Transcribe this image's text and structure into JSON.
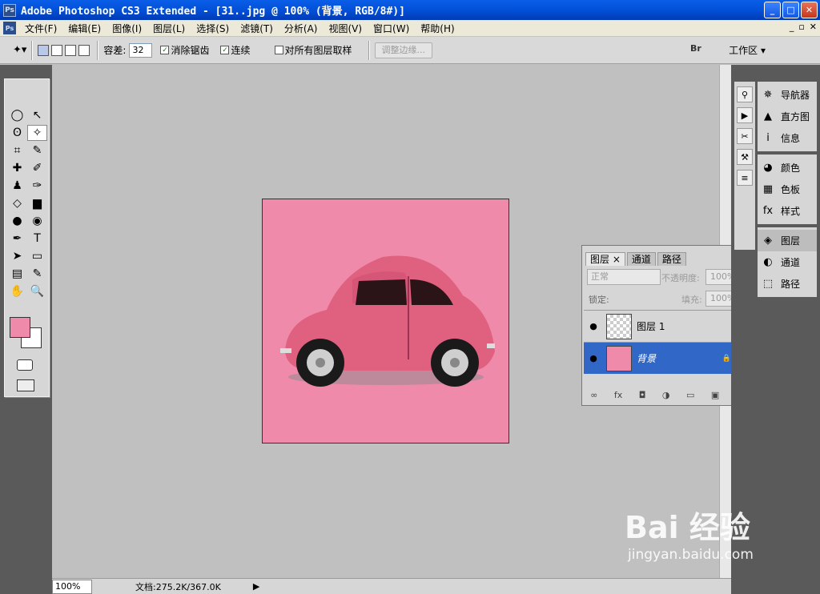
{
  "window": {
    "app_icon": "Ps",
    "title": "Adobe Photoshop CS3 Extended - [31..jpg @ 100% (背景, RGB/8#)]",
    "min": "_",
    "max": "□",
    "close": "✕"
  },
  "menu": {
    "doc_icon": "Ps",
    "items": [
      "文件(F)",
      "编辑(E)",
      "图像(I)",
      "图层(L)",
      "选择(S)",
      "滤镜(T)",
      "分析(A)",
      "视图(V)",
      "窗口(W)",
      "帮助(H)"
    ],
    "doc_min": "_",
    "doc_restore": "▫",
    "doc_close": "✕"
  },
  "options": {
    "tool_icon": "✦▾",
    "tolerance_label": "容差:",
    "tolerance_value": "32",
    "antialias_label": "消除锯齿",
    "contiguous_label": "连续",
    "sample_all_label": "对所有图层取样",
    "refine_edge": "调整边缘...",
    "workspace": "工作区 ▾",
    "bridge": "Br"
  },
  "tools": [
    "◯",
    "↖",
    "ʘ",
    "✧",
    "⌗",
    "✎",
    "✚",
    "✐",
    "♟",
    "✑",
    "◇",
    "▆",
    "●",
    "◉",
    "✒",
    "T",
    "➤",
    "▭",
    "▤",
    "✎",
    "✋",
    "🔍"
  ],
  "right_panels": {
    "group1": [
      "导航器",
      "直方图",
      "信息"
    ],
    "group2": [
      "颜色",
      "色板",
      "样式"
    ],
    "group3": [
      "图层",
      "通道",
      "路径"
    ]
  },
  "right_icons": {
    "g1": [
      "✵",
      "▲",
      "i"
    ],
    "g2": [
      "◕",
      "▦",
      "fx"
    ],
    "g3": [
      "◈",
      "◐",
      "⬚"
    ],
    "strip": [
      "⚲",
      "▶",
      "✂",
      "⚒",
      "≡"
    ]
  },
  "layers_panel": {
    "tabs": [
      "图层 ×",
      "通道",
      "路径"
    ],
    "blend_mode": "正常",
    "opacity_label": "不透明度:",
    "opacity_value": "100%",
    "lock_label": "锁定:",
    "fill_label": "填充:",
    "fill_value": "100%",
    "layers": [
      {
        "name": "图层 1",
        "eye": "●"
      },
      {
        "name": "背景",
        "eye": "●",
        "lock": "🔒"
      }
    ],
    "bottom_icons": [
      "∞",
      "fx",
      "◘",
      "◑",
      "▭",
      "▣",
      "🗑"
    ]
  },
  "status": {
    "zoom": "100%",
    "doc": "文档:275.2K/367.0K",
    "arrow": "▶"
  },
  "watermark": {
    "big": "Bai 经验",
    "small": "jingyan.baidu.com"
  },
  "colors": {
    "foreground": "#ef8aaa",
    "background": "#ffffff",
    "canvas": "#ef8aaa",
    "selected_layer": "#3167c6"
  }
}
